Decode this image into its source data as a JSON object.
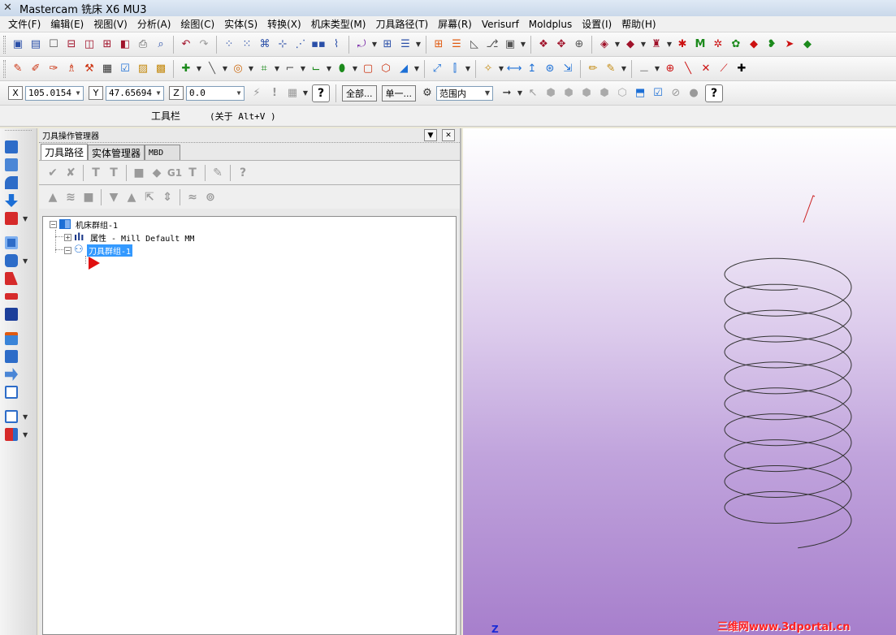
{
  "window": {
    "title": "Mastercam 铣床 X6 MU3"
  },
  "menu": [
    "文件(F)",
    "编辑(E)",
    "视图(V)",
    "分析(A)",
    "绘图(C)",
    "实体(S)",
    "转换(X)",
    "机床类型(M)",
    "刀具路径(T)",
    "屏幕(R)",
    "Verisurf",
    "Moldplus",
    "设置(I)",
    "帮助(H)"
  ],
  "coords": {
    "x_label": "X",
    "x_value": "105.0154",
    "y_label": "Y",
    "y_value": "47.65694",
    "z_label": "Z",
    "z_value": "0.0"
  },
  "selection": {
    "all_label": "全部...",
    "single_label": "单一...",
    "range_value": "范围内"
  },
  "prompt": {
    "toolbar_label": "工具栏",
    "hint": "(关于 Alt+V )"
  },
  "manager": {
    "title": "刀具操作管理器",
    "tabs": [
      "刀具路径",
      "实体管理器",
      "MBD"
    ],
    "tree": {
      "root": "机床群组-1",
      "properties": "属性 - Mill Default MM",
      "toolpath_group": "刀具群组-1"
    }
  },
  "viewport": {
    "axis_label": "Z",
    "watermark": "三维网www.3dportal.cn",
    "background_top": "#ffffff",
    "background_bottom": "#a77fcc",
    "geometry_color": "#333333",
    "start_lead_color": "#cc2222",
    "shape": "helix"
  },
  "icons": {
    "toolbar_row1": [
      "save-icon",
      "print-icon",
      "undo-icon",
      "redo-icon",
      "zoom-icon",
      "grid-icon",
      "shade-icon",
      "layer-icon",
      "color-icon"
    ],
    "toolbar_row2": [
      "point-icon",
      "line-icon",
      "arc-icon",
      "rectangle-icon",
      "spline-icon",
      "solid-icon",
      "measure-icon",
      "trim-icon",
      "cross-icon"
    ]
  }
}
